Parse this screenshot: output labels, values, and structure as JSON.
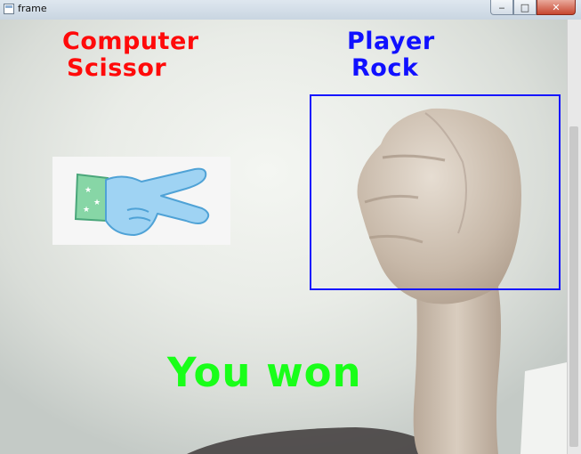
{
  "window": {
    "title": "frame",
    "controls": {
      "minimize": "‒",
      "maximize": "□",
      "close": "✕"
    }
  },
  "computer": {
    "label": "Computer",
    "move": "Scissor",
    "color": "#ff0a0a"
  },
  "player": {
    "label": "Player",
    "move": "Rock",
    "color": "#1010ff"
  },
  "result": {
    "text": "You won",
    "color": "#19ff19"
  },
  "icons": {
    "computer_move_image": "scissors-hand-icon",
    "player_hand": "fist-photo"
  }
}
